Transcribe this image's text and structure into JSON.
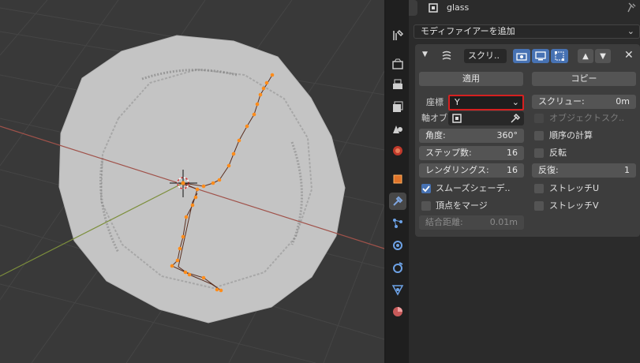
{
  "header": {
    "object_name": "glass"
  },
  "modifier_panel": {
    "add_modifier_label": "モディファイアーを追加",
    "modifier_name": "スクリ..",
    "apply_label": "適用",
    "copy_label": "コピー",
    "axis_label": "座標",
    "axis_value": "Y",
    "screw_label": "スクリュー:",
    "screw_value": "0m",
    "axis_object_label": "軸オブ",
    "object_screw_label": "オブジェクトスク..",
    "angle_label": "角度:",
    "angle_value": "360°",
    "calc_order_label": "順序の計算",
    "steps_label": "ステップ数:",
    "steps_value": "16",
    "flip_label": "反転",
    "render_steps_label": "レンダリングス:",
    "render_steps_value": "16",
    "iterations_label": "反復:",
    "iterations_value": "1",
    "smooth_shading_label": "スムーズシェーデ..",
    "stretch_u_label": "ストレッチU",
    "merge_vertices_label": "頂点をマージ",
    "stretch_v_label": "ストレッチV",
    "merge_distance_label": "結合距離:",
    "merge_distance_value": "0.01m",
    "smooth_shading_checked": true,
    "merge_vertices_checked": false,
    "calc_order_checked": false,
    "flip_checked": false,
    "stretch_u_checked": false,
    "stretch_v_checked": false
  },
  "colors": {
    "accent": "#4772b3",
    "highlight_border": "#d62020",
    "vertex": "#ff8c1a"
  }
}
